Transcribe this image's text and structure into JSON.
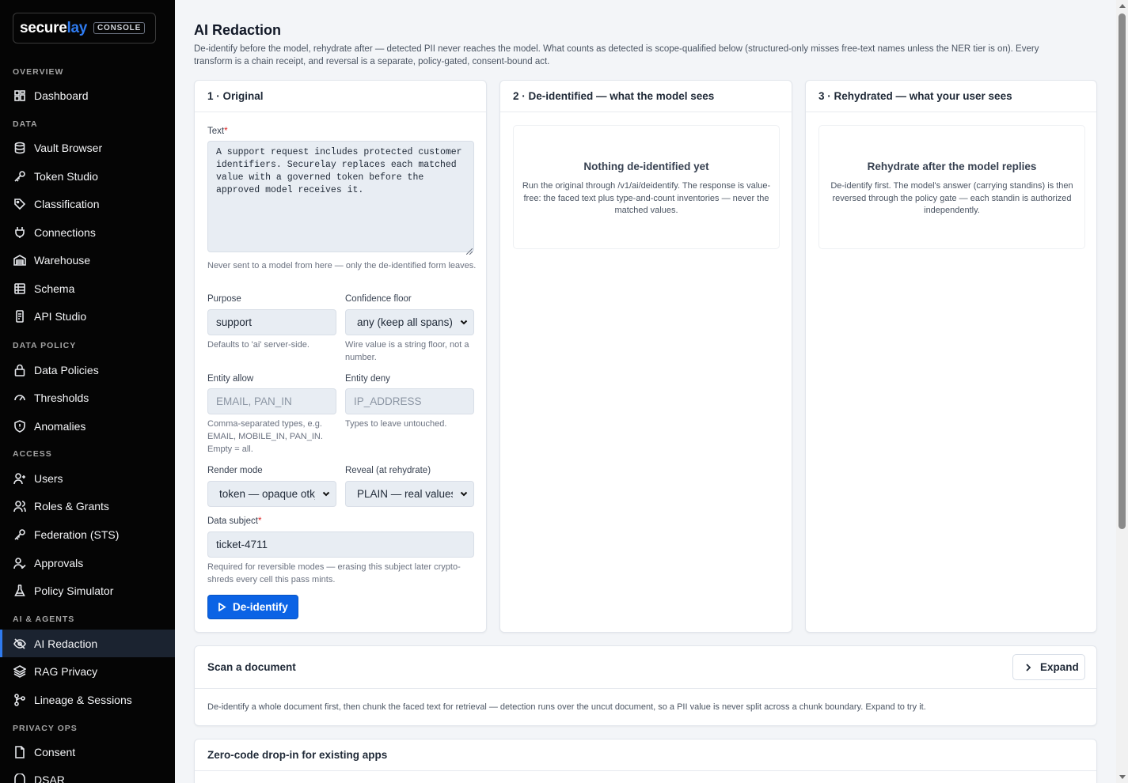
{
  "sidebar": {
    "logo": {
      "main": "secure",
      "accent": "lay",
      "badge": "CONSOLE"
    },
    "sections": [
      {
        "label": "OVERVIEW",
        "items": [
          {
            "label": "Dashboard",
            "icon": "dashboard-icon"
          }
        ]
      },
      {
        "label": "DATA",
        "items": [
          {
            "label": "Vault Browser",
            "icon": "database-icon"
          },
          {
            "label": "Token Studio",
            "icon": "key-icon"
          },
          {
            "label": "Classification",
            "icon": "tag-icon"
          },
          {
            "label": "Connections",
            "icon": "plug-icon"
          },
          {
            "label": "Warehouse",
            "icon": "warehouse-icon"
          },
          {
            "label": "Schema",
            "icon": "table-icon"
          },
          {
            "label": "API Studio",
            "icon": "api-icon"
          }
        ]
      },
      {
        "label": "DATA POLICY",
        "items": [
          {
            "label": "Data Policies",
            "icon": "lock-icon"
          },
          {
            "label": "Thresholds",
            "icon": "gauge-icon"
          },
          {
            "label": "Anomalies",
            "icon": "alert-shield-icon"
          }
        ]
      },
      {
        "label": "ACCESS",
        "items": [
          {
            "label": "Users",
            "icon": "user-plus-icon"
          },
          {
            "label": "Roles & Grants",
            "icon": "users-icon"
          },
          {
            "label": "Federation (STS)",
            "icon": "key-icon"
          },
          {
            "label": "Approvals",
            "icon": "user-check-icon"
          },
          {
            "label": "Policy Simulator",
            "icon": "flask-icon"
          }
        ]
      },
      {
        "label": "AI & AGENTS",
        "items": [
          {
            "label": "AI Redaction",
            "icon": "eye-off-icon",
            "active": true
          },
          {
            "label": "RAG Privacy",
            "icon": "layers-icon"
          },
          {
            "label": "Lineage & Sessions",
            "icon": "lineage-icon"
          }
        ]
      },
      {
        "label": "PRIVACY OPS",
        "items": [
          {
            "label": "Consent",
            "icon": "document-icon"
          },
          {
            "label": "DSAR",
            "icon": "dsar-icon"
          }
        ]
      }
    ]
  },
  "page": {
    "title": "AI Redaction",
    "description": "De-identify before the model, rehydrate after — detected PII never reaches the model. What counts as detected is scope-qualified below (structured-only misses free-text names unless the NER tier is on). Every transform is a chain receipt, and reversal is a separate, policy-gated, consent-bound act."
  },
  "original": {
    "title": "1 · Original",
    "text_label": "Text",
    "text_value": "A support request includes protected customer\nidentifiers. Securelay replaces each matched\nvalue with a governed token before the\napproved model receives it.",
    "text_help": "Never sent to a model from here — only the de-identified form leaves.",
    "purpose_label": "Purpose",
    "purpose_value": "support",
    "purpose_help": "Defaults to 'ai' server-side.",
    "confidence_label": "Confidence floor",
    "confidence_value": "any (keep all spans)",
    "confidence_help": "Wire value is a string floor, not a number.",
    "entity_allow_label": "Entity allow",
    "entity_allow_placeholder": "EMAIL, PAN_IN",
    "entity_allow_help": "Comma-separated types, e.g. EMAIL, MOBILE_IN, PAN_IN. Empty = all.",
    "entity_deny_label": "Entity deny",
    "entity_deny_placeholder": "IP_ADDRESS",
    "entity_deny_help": "Types to leave untouched.",
    "render_label": "Render mode",
    "render_value": "token — opaque otk_",
    "reveal_label": "Reveal (at rehydrate)",
    "reveal_value": "PLAIN — real values",
    "subject_label": "Data subject",
    "subject_value": "ticket-4711",
    "subject_help": "Required for reversible modes — erasing this subject later crypto-shreds every cell this pass mints.",
    "button_label": "De-identify"
  },
  "deidentified": {
    "title": "2 · De-identified — what the model sees",
    "empty_title": "Nothing de-identified yet",
    "empty_body": "Run the original through /v1/ai/deidentify. The response is value-free: the faced text plus type-and-count inventories — never the matched values."
  },
  "rehydrated": {
    "title": "3 · Rehydrated — what your user sees",
    "empty_title": "Rehydrate after the model replies",
    "empty_body": "De-identify first. The model's answer (carrying standins) is then reversed through the policy gate — each standin is authorized independently."
  },
  "scan": {
    "title": "Scan a document",
    "expand_label": "Expand",
    "body": "De-identify a whole document first, then chunk the faced text for retrieval — detection runs over the uncut document, so a PII value is never split across a chunk boundary. Expand to try it."
  },
  "dropin": {
    "title": "Zero-code drop-in for existing apps"
  },
  "colors": {
    "accent": "#0b63e5",
    "sidebar_bg": "#050505",
    "brand_accent": "#2f7bf0"
  }
}
